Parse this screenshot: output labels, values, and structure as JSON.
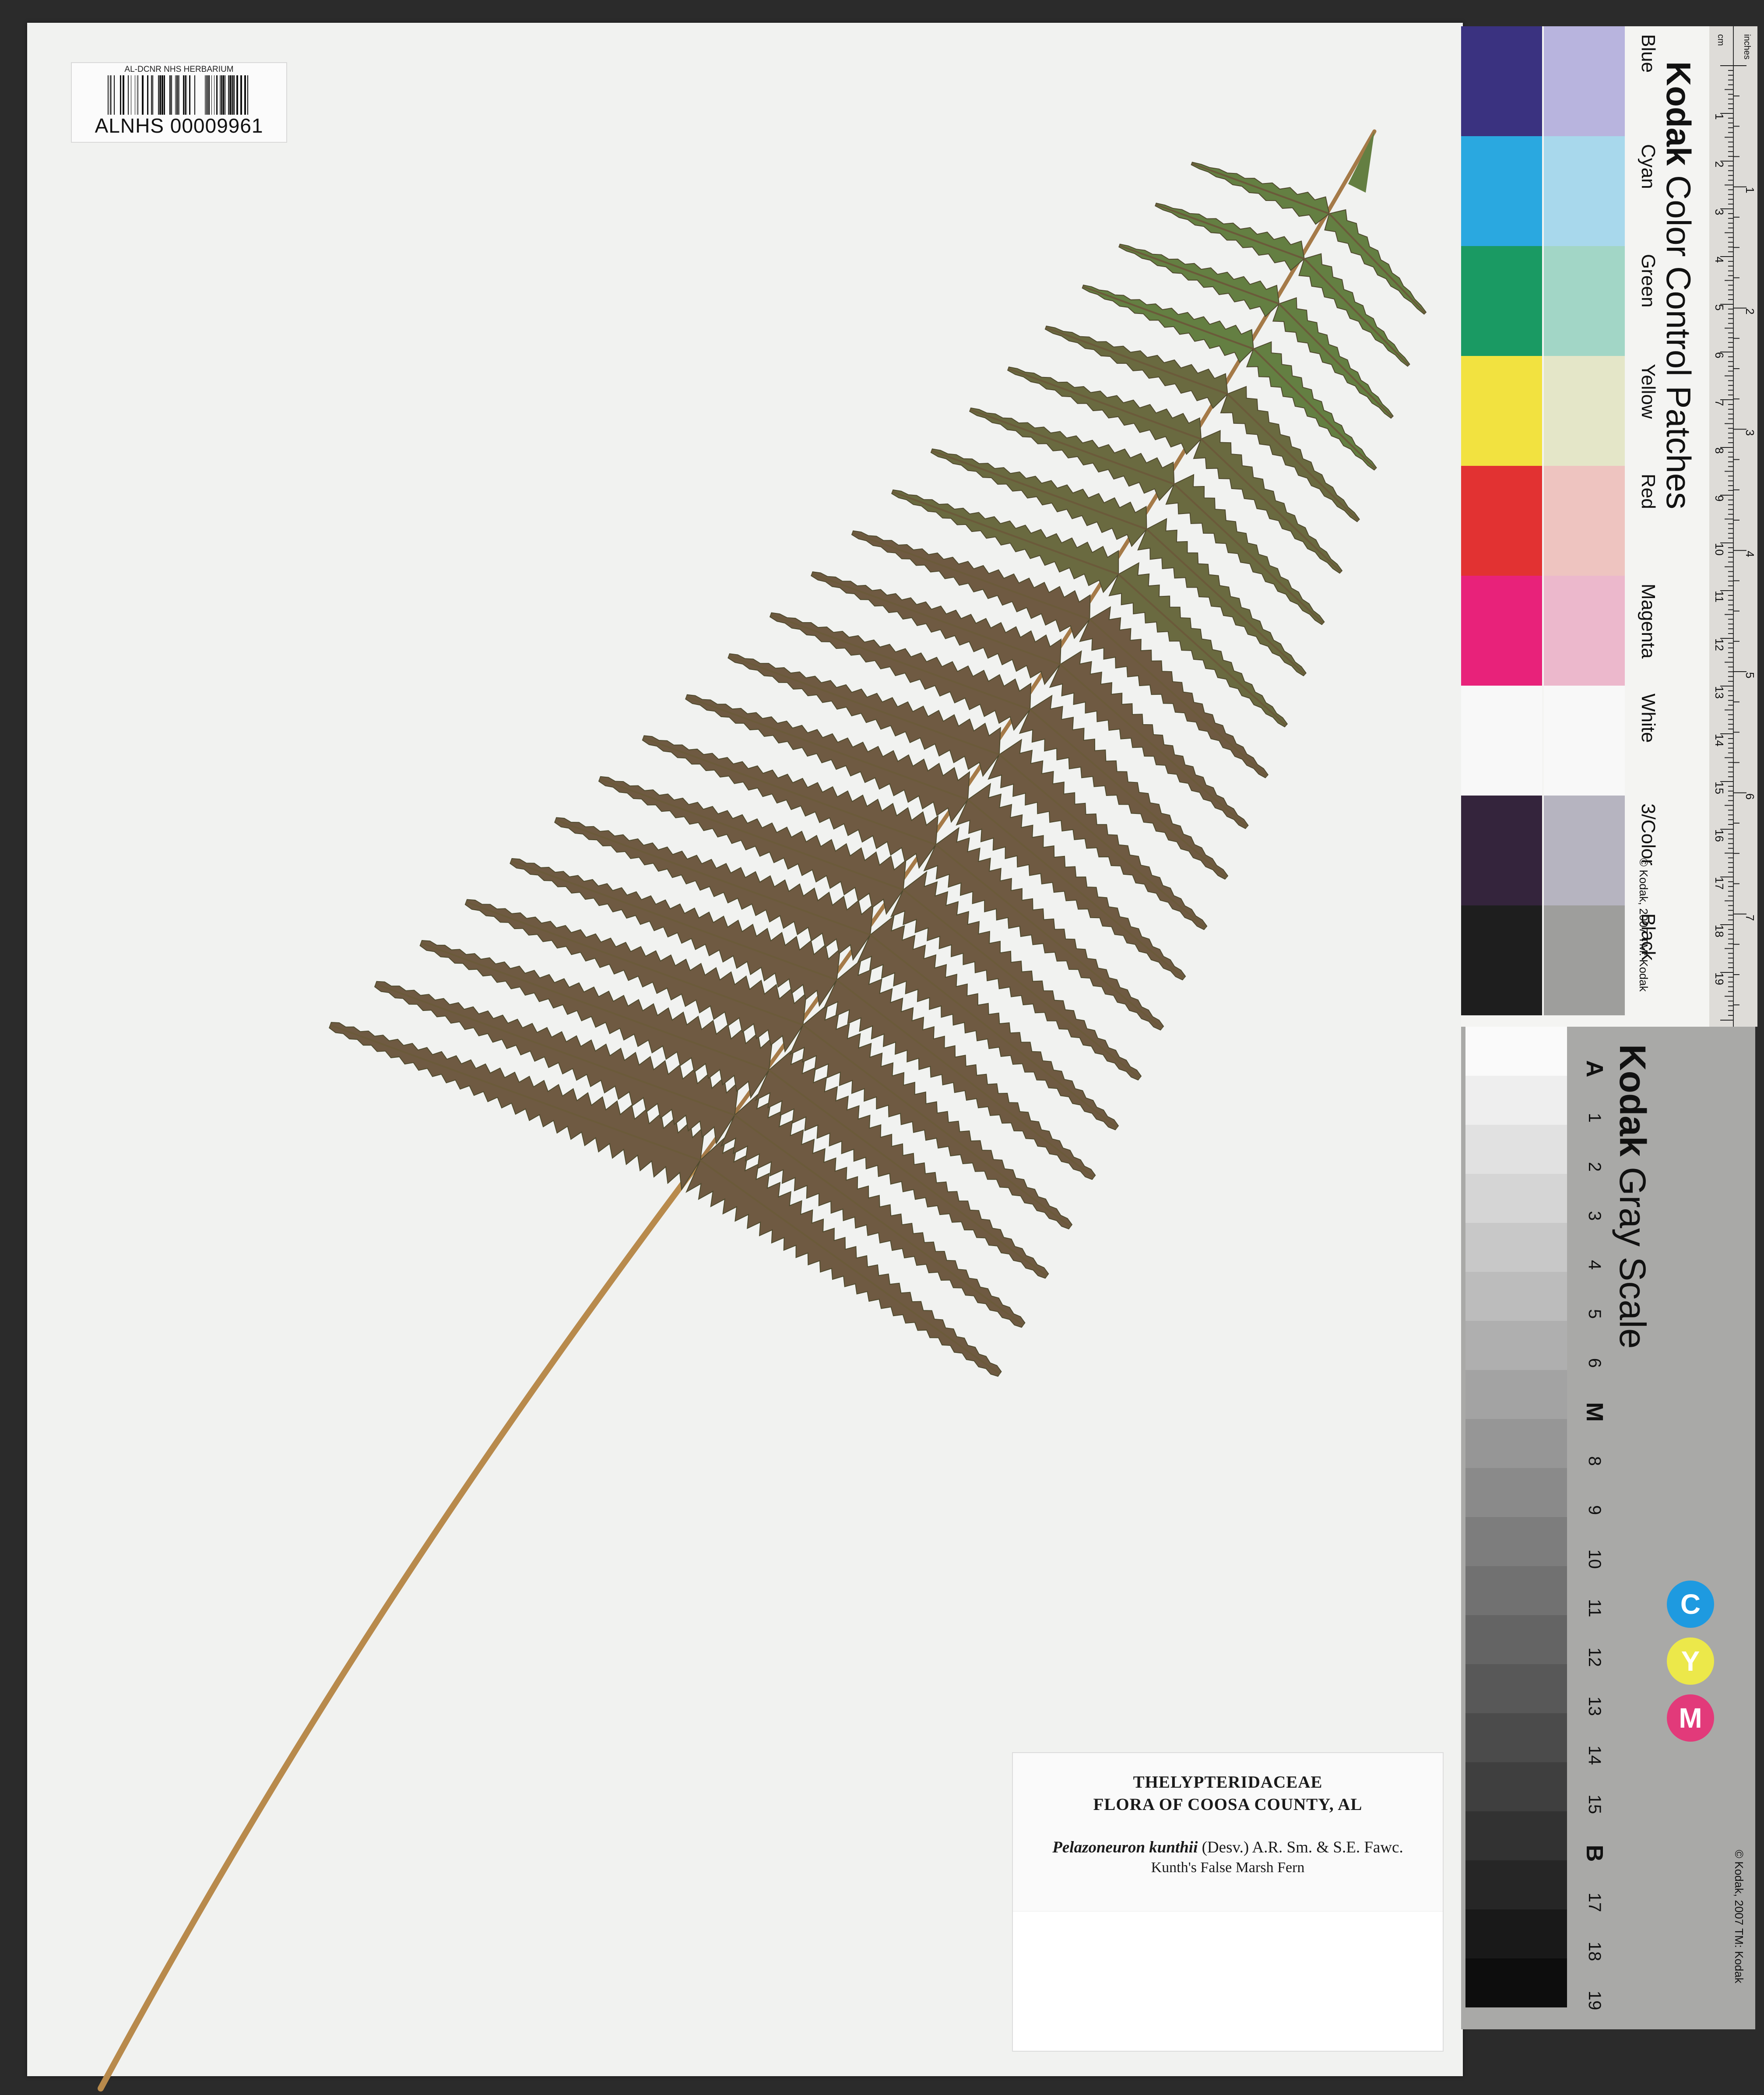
{
  "barcode": {
    "institution": "AL-DCNR NHS HERBARIUM",
    "number": "ALNHS 00009961"
  },
  "label": {
    "family": "THELYPTERIDACEAE",
    "flora": "FLORA OF COOSA COUNTY, AL",
    "scientific_name": "Pelazoneuron kunthii",
    "authority": "(Desv.) A.R. Sm. & S.E. Fawc.",
    "common_name": "Kunth's False Marsh Fern"
  },
  "color_card": {
    "brand": "Kodak",
    "title": "Color Control Patches",
    "patch_labels": [
      "Blue",
      "Cyan",
      "Green",
      "Yellow",
      "Red",
      "Magenta",
      "White",
      "3/Color",
      "Black"
    ],
    "dark_colors": [
      "#3a3280",
      "#2aa8e0",
      "#1a9a63",
      "#f2e240",
      "#e23232",
      "#e8227a",
      "#f8f8f8",
      "#34243c",
      "#1e1e1e"
    ],
    "light_colors": [
      "#b8b4de",
      "#a8d8ec",
      "#a2d6c6",
      "#e4e6c8",
      "#eec4c0",
      "#ecb8cc",
      "#f8f8f8",
      "#b6b4c0",
      "#9e9e9c"
    ],
    "copyright": "© Kodak, 2007 TM: Kodak",
    "ruler_units": [
      "cm",
      "inches"
    ],
    "ruler_cm": [
      "1",
      "2",
      "3",
      "4",
      "5",
      "6",
      "7",
      "8",
      "9",
      "10",
      "11",
      "12",
      "13",
      "14",
      "15",
      "16",
      "17",
      "18",
      "19"
    ],
    "ruler_in": [
      "1",
      "2",
      "3",
      "4",
      "5",
      "6",
      "7"
    ]
  },
  "gray_card": {
    "brand": "Kodak",
    "title": "Gray Scale",
    "steps": [
      "A",
      "1",
      "2",
      "3",
      "4",
      "5",
      "6",
      "M",
      "8",
      "9",
      "10",
      "11",
      "12",
      "13",
      "14",
      "15",
      "B",
      "17",
      "18",
      "19"
    ],
    "copyright": "© Kodak, 2007 TM: Kodak",
    "cmy": [
      "C",
      "Y",
      "M"
    ],
    "cmy_colors": [
      "#1e9ae0",
      "#ece84a",
      "#e23a7a"
    ]
  }
}
